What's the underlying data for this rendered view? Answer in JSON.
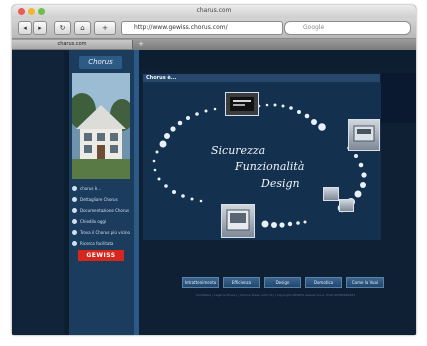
{
  "window": {
    "title": "charus.com"
  },
  "toolbar": {
    "url": "http://www.gewiss.chorus.com/",
    "search_placeholder": "Google",
    "nav_back": "◂",
    "nav_forward": "▸",
    "reload": "↻",
    "home": "⌂"
  },
  "tabs": [
    {
      "label": "charus.com"
    }
  ],
  "site": {
    "logo": "Chorus",
    "header": "Chorus è...",
    "tagline": [
      "Sicurezza",
      "Funzionalità",
      "Design"
    ],
    "nav_items": [
      {
        "label": "chorus è...",
        "icon": "circle-icon"
      },
      {
        "label": "Dettagliare Chorus",
        "icon": "circle-icon"
      },
      {
        "label": "Documentazione Chorus",
        "icon": "circle-icon"
      },
      {
        "label": "Chiedilo oggi",
        "icon": "circle-icon"
      },
      {
        "label": "Trova il Chorus più vicino",
        "icon": "circle-icon"
      },
      {
        "label": "Ricerca facilitata",
        "icon": "circle-icon"
      }
    ],
    "brand": "GEWISS",
    "buttons": [
      "Intrattenimento",
      "Efficienza",
      "Design",
      "Domotica",
      "Come la Vuoi"
    ],
    "footer": "Contattaci | Legal & Privacy | Chorus Press room (It) | Copyright GEWISS Gewiss S.p.A. P.IVA 00385600167"
  },
  "colors": {
    "accent": "#2b5a86",
    "brand": "#d7261c",
    "background": "#0f2035"
  }
}
